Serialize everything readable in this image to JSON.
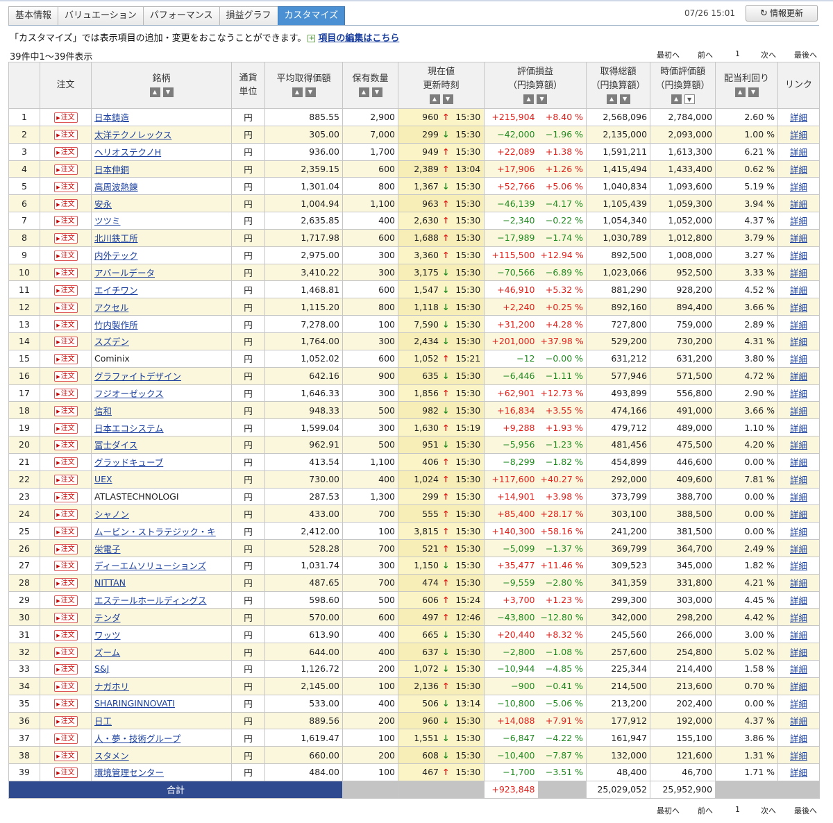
{
  "tabs": [
    {
      "label": "基本情報",
      "active": false
    },
    {
      "label": "バリュエーション",
      "active": false
    },
    {
      "label": "パフォーマンス",
      "active": false
    },
    {
      "label": "損益グラフ",
      "active": false
    },
    {
      "label": "カスタマイズ",
      "active": true
    }
  ],
  "header": {
    "timestamp": "07/26 15:01",
    "refresh_label": "情報更新"
  },
  "notice": {
    "text": "「カスタマイズ」では表示項目の追加・変更をおこなうことができます。",
    "link": "項目の編集はこちら"
  },
  "count_text": "39件中1～39件表示",
  "pager": {
    "first": "最初へ",
    "prev": "前へ",
    "page": "1",
    "next": "次へ",
    "last": "最後へ"
  },
  "columns": {
    "order": "注文",
    "name": "銘柄",
    "currency_1": "通貨",
    "currency_2": "単位",
    "avg_price": "平均取得価額",
    "quantity": "保有数量",
    "current_1": "現在値",
    "current_2": "更新時刻",
    "pl_1": "評価損益",
    "pl_2": "（円換算額）",
    "cost_1": "取得総額",
    "cost_2": "（円換算額）",
    "value_1": "時価評価額",
    "value_2": "（円換算額）",
    "yield": "配当利回り",
    "link": "リンク"
  },
  "order_label": "注文",
  "currency_unit": "円",
  "detail_label": "詳細",
  "rows": [
    {
      "no": "1",
      "name": "日本鋳造",
      "avg": "885.55",
      "qty": "2,900",
      "price": "960",
      "dir": "up",
      "time": "15:30",
      "pl": "+215,904",
      "pct": "+8.40 %",
      "cost": "2,568,096",
      "value": "2,784,000",
      "yield": "2.60 %"
    },
    {
      "no": "2",
      "name": "太洋テクノレックス",
      "avg": "305.00",
      "qty": "7,000",
      "price": "299",
      "dir": "down",
      "time": "15:30",
      "pl": "−42,000",
      "pct": "−1.96 %",
      "cost": "2,135,000",
      "value": "2,093,000",
      "yield": "1.00 %"
    },
    {
      "no": "3",
      "name": "ヘリオステクノH",
      "avg": "936.00",
      "qty": "1,700",
      "price": "949",
      "dir": "up",
      "time": "15:30",
      "pl": "+22,089",
      "pct": "+1.38 %",
      "cost": "1,591,211",
      "value": "1,613,300",
      "yield": "6.21 %"
    },
    {
      "no": "4",
      "name": "日本伸銅",
      "avg": "2,359.15",
      "qty": "600",
      "price": "2,389",
      "dir": "up",
      "time": "13:04",
      "pl": "+17,906",
      "pct": "+1.26 %",
      "cost": "1,415,494",
      "value": "1,433,400",
      "yield": "0.62 %"
    },
    {
      "no": "5",
      "name": "高周波熱錬",
      "avg": "1,301.04",
      "qty": "800",
      "price": "1,367",
      "dir": "down",
      "time": "15:30",
      "pl": "+52,766",
      "pct": "+5.06 %",
      "cost": "1,040,834",
      "value": "1,093,600",
      "yield": "5.19 %"
    },
    {
      "no": "6",
      "name": "安永",
      "avg": "1,004.94",
      "qty": "1,100",
      "price": "963",
      "dir": "up",
      "time": "15:30",
      "pl": "−46,139",
      "pct": "−4.17 %",
      "cost": "1,105,439",
      "value": "1,059,300",
      "yield": "3.94 %"
    },
    {
      "no": "7",
      "name": "ツツミ",
      "avg": "2,635.85",
      "qty": "400",
      "price": "2,630",
      "dir": "up",
      "time": "15:30",
      "pl": "−2,340",
      "pct": "−0.22 %",
      "cost": "1,054,340",
      "value": "1,052,000",
      "yield": "4.37 %"
    },
    {
      "no": "8",
      "name": "北川鉄工所",
      "avg": "1,717.98",
      "qty": "600",
      "price": "1,688",
      "dir": "up",
      "time": "15:30",
      "pl": "−17,989",
      "pct": "−1.74 %",
      "cost": "1,030,789",
      "value": "1,012,800",
      "yield": "3.79 %"
    },
    {
      "no": "9",
      "name": "内外テック",
      "avg": "2,975.00",
      "qty": "300",
      "price": "3,360",
      "dir": "up",
      "time": "15:30",
      "pl": "+115,500",
      "pct": "+12.94 %",
      "cost": "892,500",
      "value": "1,008,000",
      "yield": "3.27 %"
    },
    {
      "no": "10",
      "name": "アバールデータ",
      "avg": "3,410.22",
      "qty": "300",
      "price": "3,175",
      "dir": "down",
      "time": "15:30",
      "pl": "−70,566",
      "pct": "−6.89 %",
      "cost": "1,023,066",
      "value": "952,500",
      "yield": "3.33 %"
    },
    {
      "no": "11",
      "name": "エイチワン",
      "avg": "1,468.81",
      "qty": "600",
      "price": "1,547",
      "dir": "down",
      "time": "15:30",
      "pl": "+46,910",
      "pct": "+5.32 %",
      "cost": "881,290",
      "value": "928,200",
      "yield": "4.52 %"
    },
    {
      "no": "12",
      "name": "アクセル",
      "avg": "1,115.20",
      "qty": "800",
      "price": "1,118",
      "dir": "down",
      "time": "15:30",
      "pl": "+2,240",
      "pct": "+0.25 %",
      "cost": "892,160",
      "value": "894,400",
      "yield": "3.66 %"
    },
    {
      "no": "13",
      "name": "竹内製作所",
      "avg": "7,278.00",
      "qty": "100",
      "price": "7,590",
      "dir": "down",
      "time": "15:30",
      "pl": "+31,200",
      "pct": "+4.28 %",
      "cost": "727,800",
      "value": "759,000",
      "yield": "2.89 %"
    },
    {
      "no": "14",
      "name": "スズデン",
      "avg": "1,764.00",
      "qty": "300",
      "price": "2,434",
      "dir": "down",
      "time": "15:30",
      "pl": "+201,000",
      "pct": "+37.98 %",
      "cost": "529,200",
      "value": "730,200",
      "yield": "4.31 %"
    },
    {
      "no": "15",
      "name": "Cominix",
      "avg": "1,052.02",
      "qty": "600",
      "price": "1,052",
      "dir": "up",
      "time": "15:21",
      "pl": "−12",
      "pct": "−0.00 %",
      "cost": "631,212",
      "value": "631,200",
      "yield": "3.80 %",
      "plain": true
    },
    {
      "no": "16",
      "name": "グラファイトデザイン",
      "avg": "642.16",
      "qty": "900",
      "price": "635",
      "dir": "down",
      "time": "15:30",
      "pl": "−6,446",
      "pct": "−1.11 %",
      "cost": "577,946",
      "value": "571,500",
      "yield": "4.72 %"
    },
    {
      "no": "17",
      "name": "フジオーゼックス",
      "avg": "1,646.33",
      "qty": "300",
      "price": "1,856",
      "dir": "up",
      "time": "15:30",
      "pl": "+62,901",
      "pct": "+12.73 %",
      "cost": "493,899",
      "value": "556,800",
      "yield": "2.90 %"
    },
    {
      "no": "18",
      "name": "信和",
      "avg": "948.33",
      "qty": "500",
      "price": "982",
      "dir": "down",
      "time": "15:30",
      "pl": "+16,834",
      "pct": "+3.55 %",
      "cost": "474,166",
      "value": "491,000",
      "yield": "3.66 %"
    },
    {
      "no": "19",
      "name": "日本エコシステム",
      "avg": "1,599.04",
      "qty": "300",
      "price": "1,630",
      "dir": "up",
      "time": "15:19",
      "pl": "+9,288",
      "pct": "+1.93 %",
      "cost": "479,712",
      "value": "489,000",
      "yield": "1.10 %"
    },
    {
      "no": "20",
      "name": "冨士ダイス",
      "avg": "962.91",
      "qty": "500",
      "price": "951",
      "dir": "down",
      "time": "15:30",
      "pl": "−5,956",
      "pct": "−1.23 %",
      "cost": "481,456",
      "value": "475,500",
      "yield": "4.20 %"
    },
    {
      "no": "21",
      "name": "グラッドキューブ",
      "avg": "413.54",
      "qty": "1,100",
      "price": "406",
      "dir": "up",
      "time": "15:30",
      "pl": "−8,299",
      "pct": "−1.82 %",
      "cost": "454,899",
      "value": "446,600",
      "yield": "0.00 %"
    },
    {
      "no": "22",
      "name": "UEX",
      "avg": "730.00",
      "qty": "400",
      "price": "1,024",
      "dir": "up",
      "time": "15:30",
      "pl": "+117,600",
      "pct": "+40.27 %",
      "cost": "292,000",
      "value": "409,600",
      "yield": "7.81 %"
    },
    {
      "no": "23",
      "name": "ATLASTECHNOLOGI",
      "avg": "287.53",
      "qty": "1,300",
      "price": "299",
      "dir": "up",
      "time": "15:30",
      "pl": "+14,901",
      "pct": "+3.98 %",
      "cost": "373,799",
      "value": "388,700",
      "yield": "0.00 %",
      "plain": true
    },
    {
      "no": "24",
      "name": "シャノン",
      "avg": "433.00",
      "qty": "700",
      "price": "555",
      "dir": "up",
      "time": "15:30",
      "pl": "+85,400",
      "pct": "+28.17 %",
      "cost": "303,100",
      "value": "388,500",
      "yield": "0.00 %"
    },
    {
      "no": "25",
      "name": "ムービン・ストラテジック・キ",
      "avg": "2,412.00",
      "qty": "100",
      "price": "3,815",
      "dir": "up",
      "time": "15:30",
      "pl": "+140,300",
      "pct": "+58.16 %",
      "cost": "241,200",
      "value": "381,500",
      "yield": "0.00 %"
    },
    {
      "no": "26",
      "name": "栄電子",
      "avg": "528.28",
      "qty": "700",
      "price": "521",
      "dir": "up",
      "time": "15:30",
      "pl": "−5,099",
      "pct": "−1.37 %",
      "cost": "369,799",
      "value": "364,700",
      "yield": "2.49 %"
    },
    {
      "no": "27",
      "name": "ディーエムソリューションズ",
      "avg": "1,031.74",
      "qty": "300",
      "price": "1,150",
      "dir": "down",
      "time": "15:30",
      "pl": "+35,477",
      "pct": "+11.46 %",
      "cost": "309,523",
      "value": "345,000",
      "yield": "1.82 %"
    },
    {
      "no": "28",
      "name": "NITTAN",
      "avg": "487.65",
      "qty": "700",
      "price": "474",
      "dir": "up",
      "time": "15:30",
      "pl": "−9,559",
      "pct": "−2.80 %",
      "cost": "341,359",
      "value": "331,800",
      "yield": "4.21 %"
    },
    {
      "no": "29",
      "name": "エステールホールディングス",
      "avg": "598.60",
      "qty": "500",
      "price": "606",
      "dir": "up",
      "time": "15:24",
      "pl": "+3,700",
      "pct": "+1.23 %",
      "cost": "299,300",
      "value": "303,000",
      "yield": "4.45 %"
    },
    {
      "no": "30",
      "name": "テンダ",
      "avg": "570.00",
      "qty": "600",
      "price": "497",
      "dir": "up",
      "time": "12:46",
      "pl": "−43,800",
      "pct": "−12.80 %",
      "cost": "342,000",
      "value": "298,200",
      "yield": "4.42 %"
    },
    {
      "no": "31",
      "name": "ワッツ",
      "avg": "613.90",
      "qty": "400",
      "price": "665",
      "dir": "down",
      "time": "15:30",
      "pl": "+20,440",
      "pct": "+8.32 %",
      "cost": "245,560",
      "value": "266,000",
      "yield": "3.00 %"
    },
    {
      "no": "32",
      "name": "ズーム",
      "avg": "644.00",
      "qty": "400",
      "price": "637",
      "dir": "down",
      "time": "15:30",
      "pl": "−2,800",
      "pct": "−1.08 %",
      "cost": "257,600",
      "value": "254,800",
      "yield": "5.02 %"
    },
    {
      "no": "33",
      "name": "S&J",
      "avg": "1,126.72",
      "qty": "200",
      "price": "1,072",
      "dir": "down",
      "time": "15:30",
      "pl": "−10,944",
      "pct": "−4.85 %",
      "cost": "225,344",
      "value": "214,400",
      "yield": "1.58 %"
    },
    {
      "no": "34",
      "name": "ナガホリ",
      "avg": "2,145.00",
      "qty": "100",
      "price": "2,136",
      "dir": "up",
      "time": "15:30",
      "pl": "−900",
      "pct": "−0.41 %",
      "cost": "214,500",
      "value": "213,600",
      "yield": "0.70 %"
    },
    {
      "no": "35",
      "name": "SHARINGINNOVATI",
      "avg": "533.00",
      "qty": "400",
      "price": "506",
      "dir": "down",
      "time": "13:14",
      "pl": "−10,800",
      "pct": "−5.06 %",
      "cost": "213,200",
      "value": "202,400",
      "yield": "0.00 %"
    },
    {
      "no": "36",
      "name": "日工",
      "avg": "889.56",
      "qty": "200",
      "price": "960",
      "dir": "down",
      "time": "15:30",
      "pl": "+14,088",
      "pct": "+7.91 %",
      "cost": "177,912",
      "value": "192,000",
      "yield": "4.37 %"
    },
    {
      "no": "37",
      "name": "人・夢・技術グループ",
      "avg": "1,619.47",
      "qty": "100",
      "price": "1,551",
      "dir": "down",
      "time": "15:30",
      "pl": "−6,847",
      "pct": "−4.22 %",
      "cost": "161,947",
      "value": "155,100",
      "yield": "3.86 %"
    },
    {
      "no": "38",
      "name": "スタメン",
      "avg": "660.00",
      "qty": "200",
      "price": "608",
      "dir": "down",
      "time": "15:30",
      "pl": "−10,400",
      "pct": "−7.87 %",
      "cost": "132,000",
      "value": "121,600",
      "yield": "1.31 %"
    },
    {
      "no": "39",
      "name": "環境管理センター",
      "avg": "484.00",
      "qty": "100",
      "price": "467",
      "dir": "up",
      "time": "15:30",
      "pl": "−1,700",
      "pct": "−3.51 %",
      "cost": "48,400",
      "value": "46,700",
      "yield": "1.71 %"
    }
  ],
  "total": {
    "label": "合計",
    "pl": "+923,848",
    "cost": "25,029,052",
    "value": "25,952,900"
  },
  "colors": {
    "positive": "#e0201b",
    "negative": "#1f8a1f",
    "active_tab": "#4a90d2",
    "total_bar": "#2f4a8e",
    "row_alt": "#fbf7dc",
    "link": "#1a3f9e"
  }
}
